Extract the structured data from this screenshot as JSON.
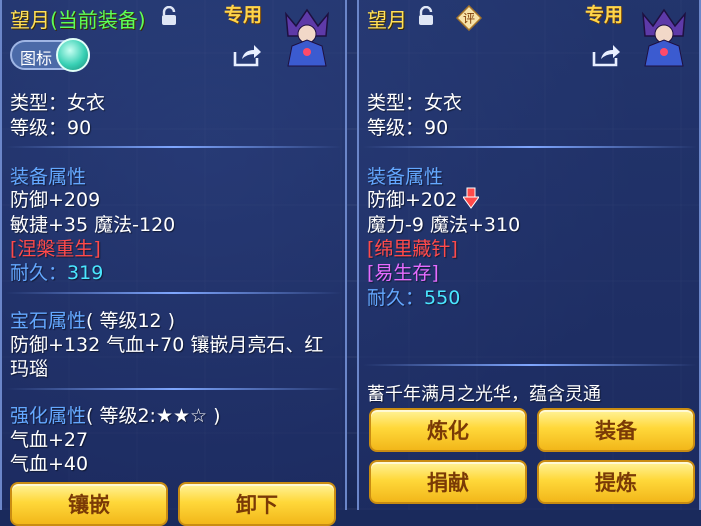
{
  "left": {
    "name": "望月",
    "equip_tag": "(当前装备)",
    "special": "专用",
    "icon_toggle_label": "图标",
    "type": "类型：女衣",
    "level": "等级：90",
    "attr_title": "装备属性",
    "attr_lines": [
      "防御+209",
      "敏捷+35 魔法-120"
    ],
    "special_effect": "[涅槃重生]",
    "durability_label": "耐久：",
    "durability_value": "319",
    "gem_title": "宝石属性",
    "gem_level": "( 等级12 )",
    "gem_line1": "防御+132 气血+70 镶嵌月亮石、红",
    "gem_line2": "玛瑙",
    "enhance_title": "强化属性",
    "enhance_level": "( 等级2:★★☆ )",
    "enhance_lines": [
      "气血+27",
      "气血+40"
    ],
    "buttons": [
      "镶嵌",
      "卸下"
    ]
  },
  "right": {
    "name": "望月",
    "special": "专用",
    "rate_label": "评",
    "type": "类型：女衣",
    "level": "等级：90",
    "attr_title": "装备属性",
    "attr_line1": "防御+202",
    "attr_line2": "魔力-9 魔法+310",
    "special_effect1": "[绵里藏针]",
    "special_effect2": "[易生存]",
    "durability_label": "耐久：",
    "durability_value": "550",
    "description": "蓄千年满月之光华，蕴含灵通",
    "buttons": [
      "炼化",
      "装备",
      "捐献",
      "提炼"
    ]
  },
  "colors": {
    "name": "#ffe05a",
    "equip_tag": "#5dff58",
    "section": "#64a8ff",
    "effect_red": "#ff4a4a",
    "effect_pink": "#e66cff",
    "durability": "#4ae6ff",
    "button": "#ffd83a",
    "decrease_arrow": "#ff4a4a"
  }
}
